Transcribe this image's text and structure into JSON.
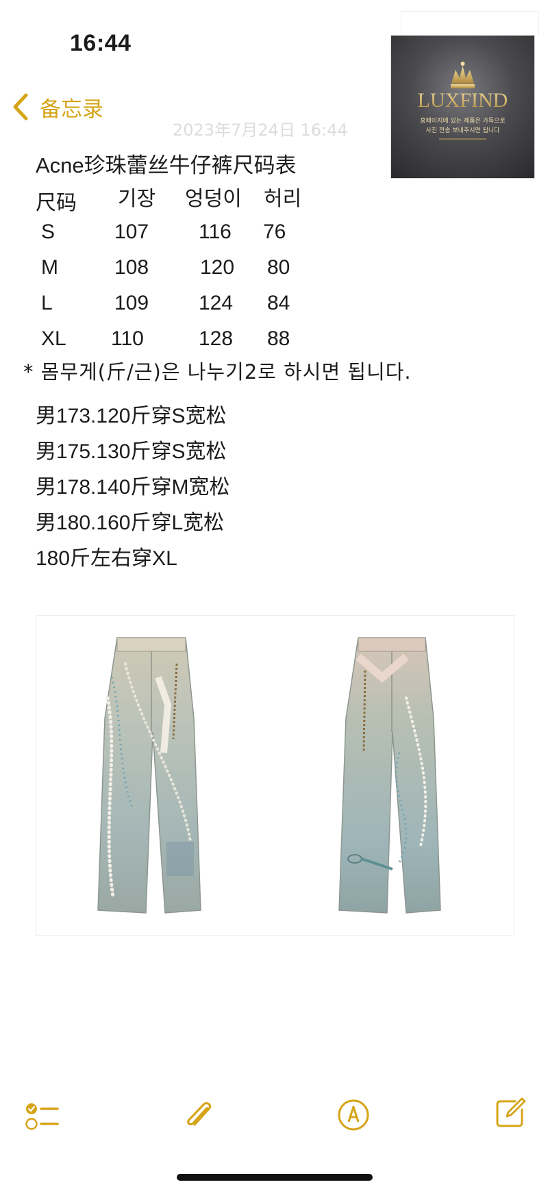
{
  "status_bar": {
    "time": "16:44"
  },
  "nav": {
    "back_label": "备忘录",
    "date_ghost": "2023年7月24日 16:44"
  },
  "logo": {
    "brand": "LUXFIND",
    "tagline_1": "홈페이지에 있는 제품은 가득으로",
    "tagline_2": "사진 전송 보내주시면 됩니다"
  },
  "note": {
    "title": "Acne珍珠蕾丝牛仔裤尺码表",
    "size_table": {
      "headers": [
        "尺码",
        "기장",
        "엉덩이",
        "허리"
      ],
      "rows": [
        [
          "S",
          "107",
          "116",
          "76"
        ],
        [
          "M",
          "108",
          "120",
          "80"
        ],
        [
          "L",
          "109",
          "124",
          "84"
        ],
        [
          "XL",
          "110",
          "128",
          "88"
        ]
      ]
    },
    "weight_note": "* 몸무게(斤/근)은 나누기2로 하시면 됩니다.",
    "recommendations": [
      "男173.120斤穿S宽松",
      "男175.130斤穿S宽松",
      "男178.140斤穿M宽松",
      "男180.160斤穿L宽松",
      "180斤左右穿XL"
    ]
  },
  "toolbar": {
    "checklist_icon": "checklist-icon",
    "attachment_icon": "paperclip-icon",
    "markup_icon": "pen-circle-icon",
    "compose_icon": "compose-icon"
  },
  "colors": {
    "accent": "#d6a417",
    "text": "#1c1c1e",
    "background": "#ffffff"
  }
}
